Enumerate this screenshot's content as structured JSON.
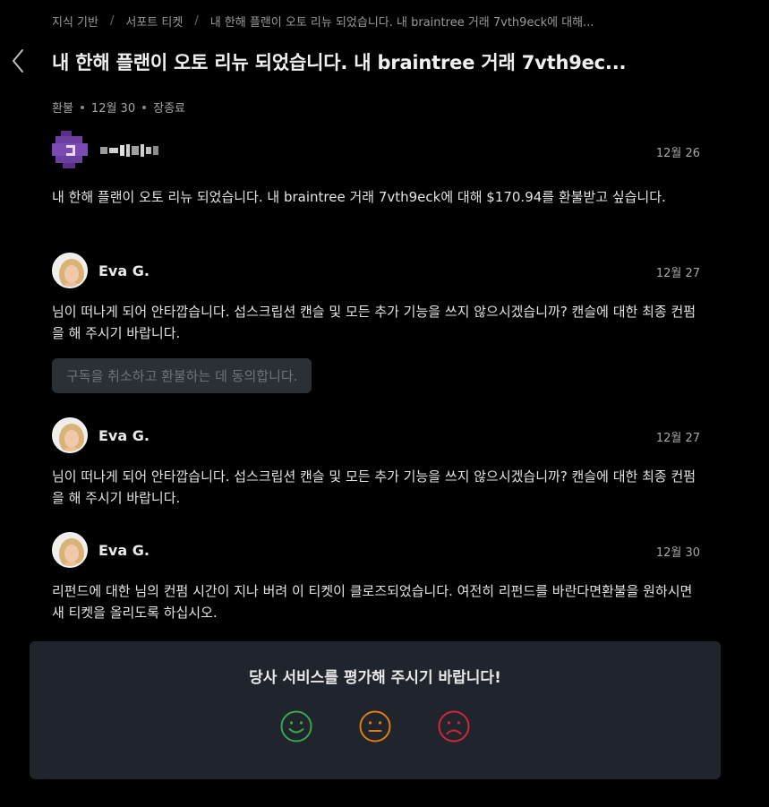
{
  "breadcrumb": {
    "items": [
      "지식 기반",
      "서포트 티켓",
      "내 한해 플랜이 오토 리뉴 되었습니다. 내 braintree 거래 7vth9eck에 대해..."
    ],
    "separator": "/"
  },
  "ticket": {
    "title": "내 한해 플랜이 오토 리뉴 되었습니다. 내 braintree 거래 7vth9ec...",
    "meta": [
      "환불",
      "12월 30",
      "장종료"
    ]
  },
  "messages": [
    {
      "author": "",
      "date": "12월 26",
      "body": "내 한해 플랜이 오토 리뉴 되었습니다. 내 braintree 거래 7vth9eck에 대해 $170.94를 환불받고 싶습니다."
    },
    {
      "author": "Eva G.",
      "date": "12월 27",
      "body": "님이 떠나게 되어 안타깝습니다. 섭스크립션 캔슬 및 모든 추가 기능을 쓰지 않으시겠습니까? 캔슬에 대한 최종 컨펌을 해 주시기 바랍니다.",
      "button": "구독을 취소하고 환불하는 데 동의합니다."
    },
    {
      "author": "Eva G.",
      "date": "12월 27",
      "body": "님이 떠나게 되어 안타깝습니다. 섭스크립션 캔슬 및 모든 추가 기능을 쓰지 않으시겠습니까? 캔슬에 대한 최종 컨펌을 해 주시기 바랍니다."
    },
    {
      "author": "Eva G.",
      "date": "12월 30",
      "body": "리펀드에 대한 님의 컨펌 시간이 지나 버려 이 티켓이 클로즈되었습니다. 여전히 리펀드를 바란다면환불을 원하시면 새 티켓을 올리도록 하십시오."
    }
  ],
  "rating": {
    "title": "당사 서비스를 평가해 주시기 바랍니다!",
    "options": [
      {
        "icon": "happy-face-icon",
        "color": "#3aa84a"
      },
      {
        "icon": "neutral-face-icon",
        "color": "#e07d10"
      },
      {
        "icon": "sad-face-icon",
        "color": "#d0283a"
      }
    ]
  },
  "colors": {
    "background": "#000000",
    "panel": "#20242c",
    "button_bg": "#2b2f36",
    "user_avatar": "#6b3fa0"
  }
}
